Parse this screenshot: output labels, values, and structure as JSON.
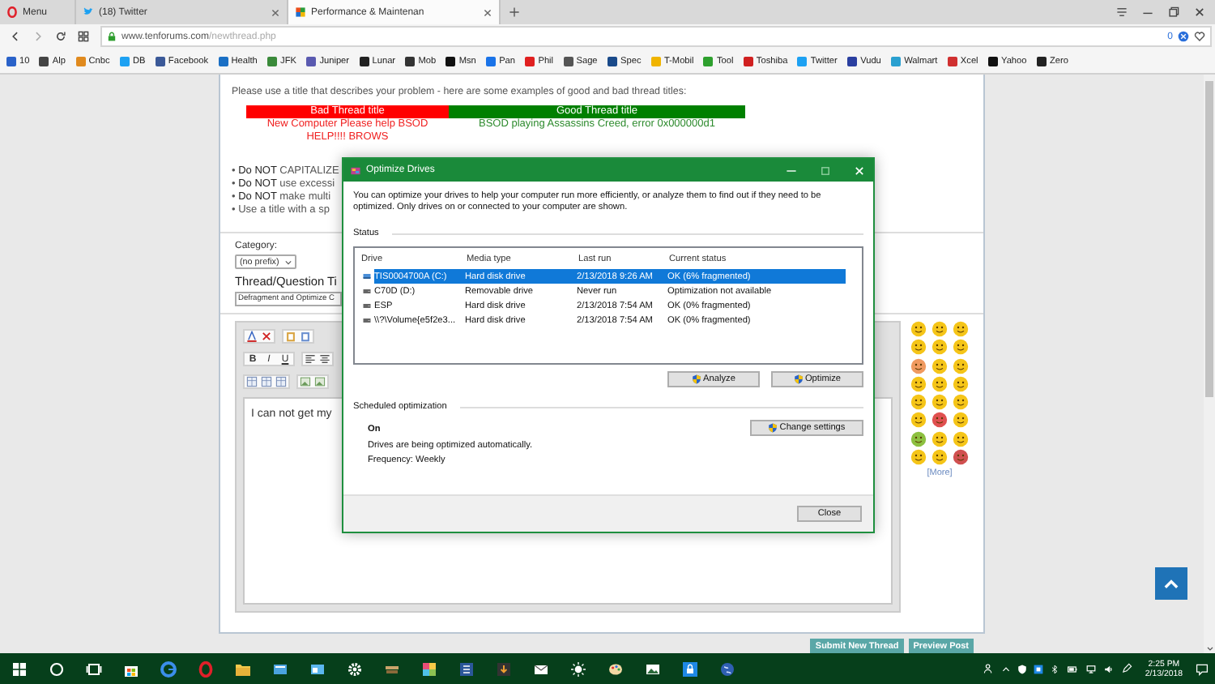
{
  "browser": {
    "tabs": [
      {
        "label": "Menu",
        "kind": "menu",
        "selected": false
      },
      {
        "label": "(18) Twitter",
        "kind": "site",
        "selected": false
      },
      {
        "label": "Performance & Maintenan",
        "kind": "site",
        "selected": true
      }
    ],
    "address": {
      "host": "www.tenforums.com",
      "path": "/newthread.php"
    },
    "blocked_count": "0",
    "bookmarks": [
      {
        "label": "10",
        "color": "#2a62c9"
      },
      {
        "label": "Alp",
        "color": "#444444"
      },
      {
        "label": "Cnbc",
        "color": "#e08a1e"
      },
      {
        "label": "DB",
        "color": "#1da1f2"
      },
      {
        "label": "Facebook",
        "color": "#3b5998"
      },
      {
        "label": "Health",
        "color": "#1a6fc4"
      },
      {
        "label": "JFK",
        "color": "#3a8a3a"
      },
      {
        "label": "Juniper",
        "color": "#5a5ab0"
      },
      {
        "label": "Lunar",
        "color": "#222222"
      },
      {
        "label": "Mob",
        "color": "#333333"
      },
      {
        "label": "Msn",
        "color": "#111111"
      },
      {
        "label": "Pan",
        "color": "#1a73e8"
      },
      {
        "label": "Phil",
        "color": "#e02020"
      },
      {
        "label": "Sage",
        "color": "#555555"
      },
      {
        "label": "Spec",
        "color": "#1a4a8a"
      },
      {
        "label": "T-Mobil",
        "color": "#f0b400"
      },
      {
        "label": "Tool",
        "color": "#2ea02e"
      },
      {
        "label": "Toshiba",
        "color": "#d02020"
      },
      {
        "label": "Twitter",
        "color": "#1da1f2"
      },
      {
        "label": "Vudu",
        "color": "#2a3fa0"
      },
      {
        "label": "Walmart",
        "color": "#2aa0d0"
      },
      {
        "label": "Xcel",
        "color": "#d03030"
      },
      {
        "label": "Yahoo",
        "color": "#111111"
      },
      {
        "label": "Zero",
        "color": "#222222"
      }
    ]
  },
  "page": {
    "intro": "Please use a title that describes your problem - here are some examples of good and bad thread titles:",
    "title_table": {
      "columns": [
        "Bad Thread title",
        "Good Thread title"
      ],
      "rows": [
        [
          "New Computer Please help BSOD",
          "BSOD playing Assassins Creed, error 0x000000d1"
        ],
        [
          "HELP!!!! BROWS"
        ]
      ]
    },
    "rules": [
      "• **Do NOT** CAPITALIZE",
      "• **Do NOT** use excessi",
      "• **Do NOT** make multi",
      "• Use a title with a sp"
    ],
    "category_label": "Category:",
    "category_value": "(no prefix)",
    "title_heading": "Thread/Question Ti",
    "title_value": "Defragment and Optimize C",
    "format_buttons": [
      "B",
      "I",
      "U"
    ],
    "message": "I can not get my",
    "more_link": "[More]",
    "buttons": [
      "Submit New Thread",
      "Preview Post"
    ]
  },
  "dialog": {
    "title": "Optimize Drives",
    "intro": "You can optimize your drives to help your computer run more efficiently, or analyze them to find out if they need to be optimized. Only drives on or connected to your computer are shown.",
    "status_heading": "Status",
    "columns": [
      "Drive",
      "Media type",
      "Last run",
      "Current status"
    ],
    "drives": [
      {
        "drive": "TIS0004700A (C:)",
        "media": "Hard disk drive",
        "last_run": "2/13/2018 9:26 AM",
        "status": "OK (6% fragmented)",
        "selected": true
      },
      {
        "drive": "C70D (D:)",
        "media": "Removable drive",
        "last_run": "Never run",
        "status": "Optimization not available",
        "selected": false
      },
      {
        "drive": "ESP",
        "media": "Hard disk drive",
        "last_run": "2/13/2018 7:54 AM",
        "status": "OK (0% fragmented)",
        "selected": false
      },
      {
        "drive": "\\\\?\\Volume{e5f2e3...",
        "media": "Hard disk drive",
        "last_run": "2/13/2018 7:54 AM",
        "status": "OK (0% fragmented)",
        "selected": false
      }
    ],
    "actions": [
      "Analyze",
      "Optimize"
    ],
    "schedule_heading": "Scheduled optimization",
    "schedule_state": "On",
    "schedule_note": "Drives are being optimized automatically.",
    "frequency": "Frequency: Weekly",
    "change_button": "Change settings",
    "close_button": "Close"
  },
  "taskbar": {
    "time": "2:25 PM",
    "date": "2/13/2018"
  }
}
